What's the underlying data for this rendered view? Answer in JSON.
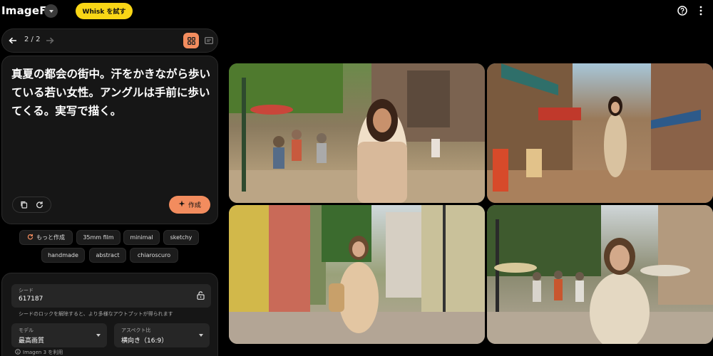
{
  "app": {
    "title": "ImageFX",
    "whisk_button": "Whisk を試す"
  },
  "nav": {
    "counter": "2 / 2"
  },
  "prompt": {
    "text": "真夏の都会の街中。汗をかきながら歩いている若い女性。アングルは手前に歩いてくる。実写で描く。"
  },
  "actions": {
    "create_label": "作成"
  },
  "chips": {
    "more": "もっと作成",
    "items": [
      "35mm film",
      "minimal",
      "sketchy",
      "handmade",
      "abstract",
      "chiaroscuro"
    ]
  },
  "settings": {
    "seed_label": "シード",
    "seed_value": "617187",
    "seed_hint": "シードのロックを解除すると、より多様なアウトプットが得られます",
    "model_label": "モデル",
    "model_value": "最高画質",
    "aspect_label": "アスペクト比",
    "aspect_value": "横向き（16:9）",
    "imagen_note": "Imagen 3 を利用"
  },
  "colors": {
    "accent": "#f28c5e",
    "whisk": "#f9d616",
    "panel": "#161616"
  },
  "icons": [
    "chevron-down-icon",
    "help-icon",
    "more-vert-icon",
    "arrow-back-icon",
    "arrow-forward-icon",
    "grid-view-icon",
    "single-view-icon",
    "copy-icon",
    "refresh-icon",
    "sparkle-icon",
    "lock-open-icon",
    "info-icon"
  ]
}
